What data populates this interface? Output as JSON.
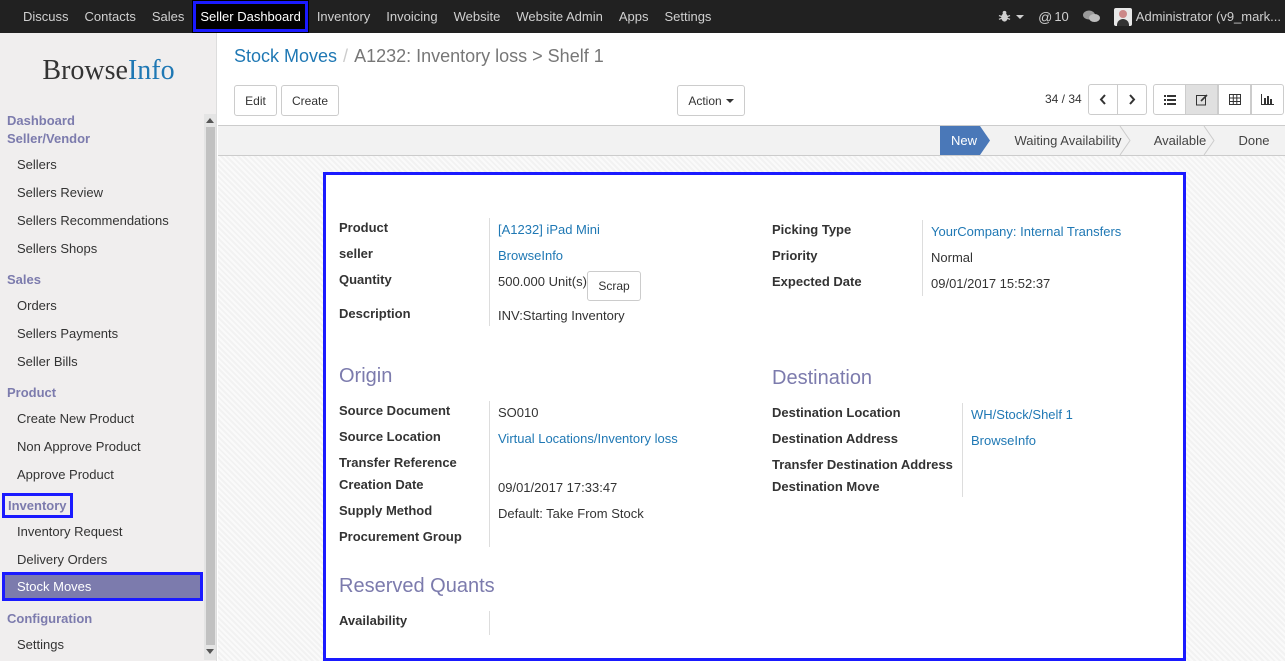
{
  "topbar": {
    "menu": [
      "Discuss",
      "Contacts",
      "Sales",
      "Seller Dashboard",
      "Inventory",
      "Invoicing",
      "Website",
      "Website Admin",
      "Apps",
      "Settings"
    ],
    "messages_count": "10",
    "user": "Administrator (v9_mark..."
  },
  "sidebar": {
    "logo_a": "Browse",
    "logo_b": "Info",
    "sections": {
      "dashboard": "Dashboard",
      "seller_vendor": "Seller/Vendor",
      "sales": "Sales",
      "product": "Product",
      "inventory": "Inventory",
      "configuration": "Configuration"
    },
    "items": {
      "sellers": "Sellers",
      "sellers_review": "Sellers Review",
      "sellers_recommendations": "Sellers Recommendations",
      "sellers_shops": "Sellers Shops",
      "orders": "Orders",
      "sellers_payments": "Sellers Payments",
      "seller_bills": "Seller Bills",
      "create_new_product": "Create New Product",
      "non_approve_product": "Non Approve Product",
      "approve_product": "Approve Product",
      "inventory_request": "Inventory Request",
      "delivery_orders": "Delivery Orders",
      "stock_moves": "Stock Moves",
      "settings": "Settings"
    }
  },
  "breadcrumb": {
    "parent": "Stock Moves",
    "separator": "/",
    "current": "A1232: Inventory loss > Shelf 1"
  },
  "buttons": {
    "edit": "Edit",
    "create": "Create",
    "action": "Action",
    "scrap": "Scrap"
  },
  "pager": "34 / 34",
  "stages": [
    "New",
    "Waiting Availability",
    "Available",
    "Done"
  ],
  "form": {
    "product_label": "Product",
    "product": "[A1232] iPad Mini",
    "seller_label": "seller",
    "seller": "BrowseInfo",
    "quantity_label": "Quantity",
    "quantity": "500.000",
    "uom": "Unit(s)",
    "description_label": "Description",
    "description": "INV:Starting Inventory",
    "picking_type_label": "Picking Type",
    "picking_type": "YourCompany: Internal Transfers",
    "priority_label": "Priority",
    "priority": "Normal",
    "expected_date_label": "Expected Date",
    "expected_date": "09/01/2017 15:52:37",
    "origin_title": "Origin",
    "source_document_label": "Source Document",
    "source_document": "SO010",
    "source_location_label": "Source Location",
    "source_location": "Virtual Locations/Inventory loss",
    "transfer_reference_label": "Transfer Reference",
    "creation_date_label": "Creation Date",
    "creation_date": "09/01/2017 17:33:47",
    "supply_method_label": "Supply Method",
    "supply_method": "Default: Take From Stock",
    "procurement_group_label": "Procurement Group",
    "destination_title": "Destination",
    "destination_location_label": "Destination Location",
    "destination_location": "WH/Stock/Shelf 1",
    "destination_address_label": "Destination Address",
    "destination_address": "BrowseInfo",
    "transfer_destination_address_label": "Transfer Destination Address",
    "destination_move_label": "Destination Move",
    "reserved_title": "Reserved Quants",
    "availability_label": "Availability"
  }
}
